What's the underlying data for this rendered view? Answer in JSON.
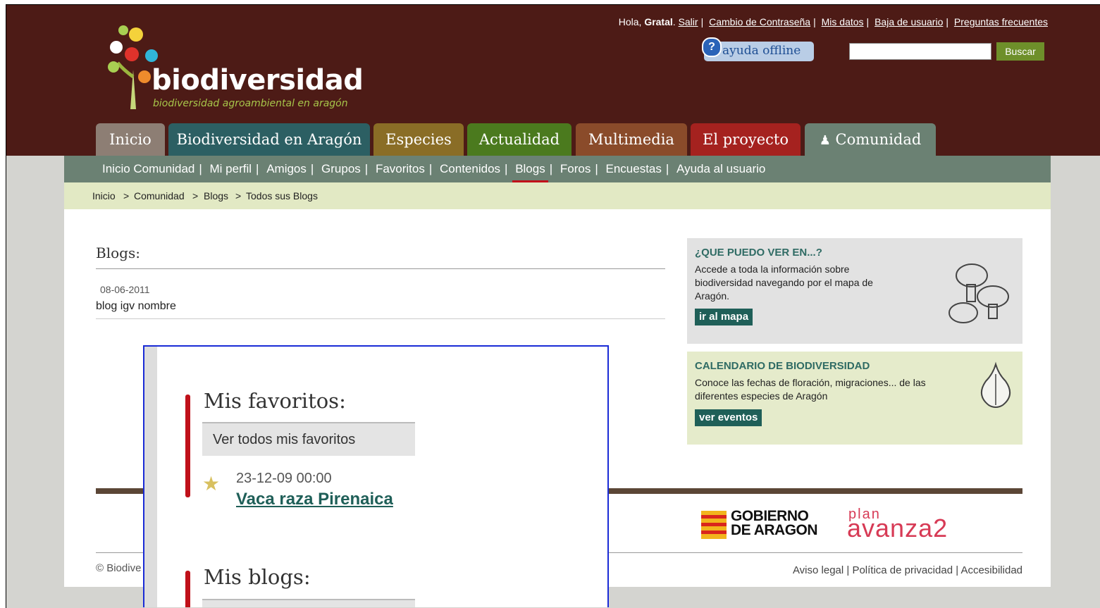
{
  "brand": {
    "name": "biodiversidad",
    "tagline": "biodiversidad agroambiental en aragón"
  },
  "toplinks": {
    "greeting": "Hola,",
    "user": "Gratal",
    "logout": "Salir",
    "change_password": "Cambio de Contraseña",
    "my_data": "Mis datos",
    "unsubscribe": "Baja de usuario",
    "faq": "Preguntas frecuentes"
  },
  "help": {
    "label": "ayuda offline"
  },
  "search": {
    "button": "Buscar",
    "value": ""
  },
  "tabs": [
    {
      "label": "Inicio",
      "color": "#8d7e74"
    },
    {
      "label": "Biodiversidad en Aragón",
      "color": "#2c5f63"
    },
    {
      "label": "Especies",
      "color": "#8a6d26"
    },
    {
      "label": "Actualidad",
      "color": "#4b7a1e"
    },
    {
      "label": "Multimedia",
      "color": "#8a4b2a"
    },
    {
      "label": "El proyecto",
      "color": "#a5221f"
    },
    {
      "label": "Comunidad",
      "color": "#6b8173"
    }
  ],
  "subnav": [
    "Inicio Comunidad",
    "Mi perfil",
    "Amigos",
    "Grupos",
    "Favoritos",
    "Contenidos",
    "Blogs",
    "Foros",
    "Encuestas",
    "Ayuda al usuario"
  ],
  "breadcrumb": [
    "Inicio",
    ">",
    "Comunidad",
    ">",
    "Blogs",
    ">",
    "Todos sus Blogs"
  ],
  "main": {
    "title": "Blogs:",
    "entries": [
      {
        "date": "08-06-2011",
        "name": "blog igv nombre"
      }
    ]
  },
  "sidebar": {
    "map_box": {
      "title": "¿QUE PUEDO VER EN...?",
      "text": "Accede a toda la información sobre biodiversidad navegando por el mapa de Aragón.",
      "button": "ir al mapa"
    },
    "calendar_box": {
      "title": "CALENDARIO DE BIODIVERSIDAD",
      "text": "Conoce las fechas de floración, migraciones... de las diferentes especies de Aragón",
      "button": "ver eventos"
    }
  },
  "footer": {
    "copyright": "© Biodive",
    "links": [
      "Aviso legal",
      "Política de privacidad",
      "Accesibilidad"
    ],
    "gov_logo": "GOBIERNO DE ARAGON",
    "plan_word": "plan",
    "avanza_logo": "avanza2"
  },
  "zoom": {
    "favorites_title": "Mis favoritos:",
    "favorites_button": "Ver todos mis favoritos",
    "fav_date": "23-12-09 00:00",
    "fav_link": "Vaca raza Pirenaica",
    "blogs_title": "Mis blogs:"
  },
  "colors": {
    "header_bg": "#4d1b16",
    "subnav_bg": "#6b8173",
    "accent_red": "#c0111a",
    "zoom_border": "#1a2bd6"
  }
}
